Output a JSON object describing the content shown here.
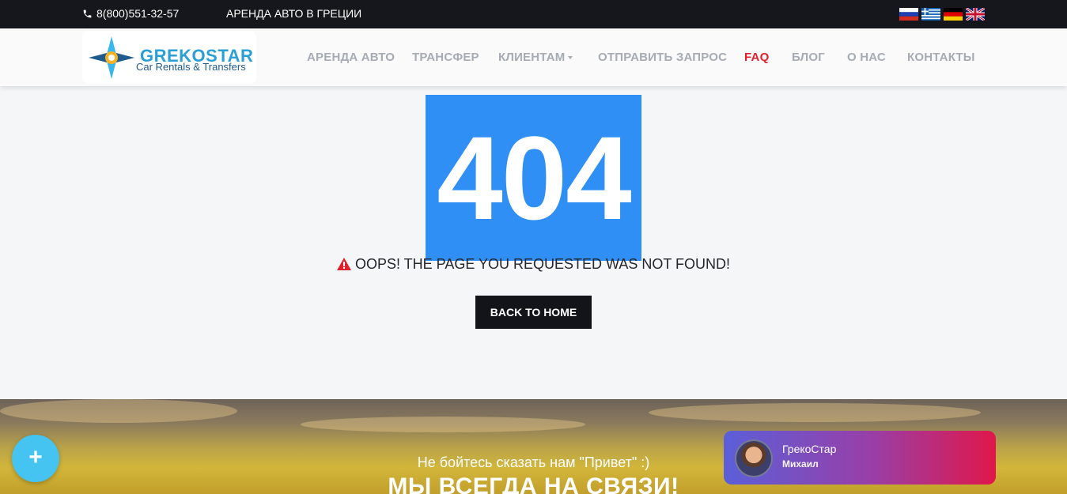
{
  "topbar": {
    "phone": "8(800)551-32-57",
    "tagline": "АРЕНДА АВТО В ГРЕЦИИ",
    "flags": [
      "russian-flag",
      "greek-flag",
      "german-flag",
      "british-flag"
    ]
  },
  "logo": {
    "brand": "GREKOSTAR",
    "sub": "Car Rentals & Transfers"
  },
  "nav": {
    "items": [
      {
        "label": "АРЕНДА АВТО"
      },
      {
        "label": "ТРАНСФЕР"
      },
      {
        "label": "КЛИЕНТАМ"
      },
      {
        "label": "ОТПРАВИТЬ ЗАПРОС"
      },
      {
        "label": "FAQ"
      },
      {
        "label": "БЛОГ"
      },
      {
        "label": "О НАС"
      },
      {
        "label": "КОНТАКТЫ"
      }
    ],
    "active": "FAQ"
  },
  "error": {
    "code": "404",
    "message": "OOPS! THE PAGE YOU REQUESTED WAS NOT FOUND!",
    "button": "BACK TO HOME"
  },
  "hero": {
    "say": "Не бойтесь сказать нам \"Привет\" :)",
    "big": "МЫ ВСЕГДА НА СВЯЗИ!"
  },
  "fab": {
    "label": "+"
  },
  "chat": {
    "name": "ГрекоСтар",
    "agent": "Михаил"
  },
  "colors": {
    "accent_blue": "#2f8ff5",
    "active_nav": "#e0202e",
    "topbar_bg": "#15171c",
    "fab_bg": "#45c3f1"
  }
}
